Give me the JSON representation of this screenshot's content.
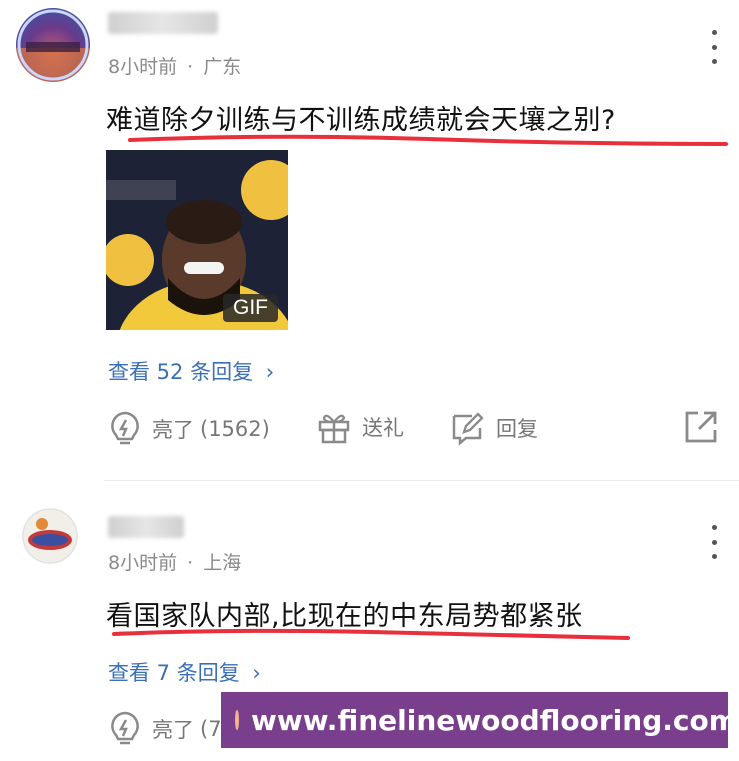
{
  "comments": [
    {
      "time": "8小时前",
      "separator": "·",
      "location": "广东",
      "text": "难道除夕训练与不训练成绩就会天壤之别?",
      "image_badge": "GIF",
      "replies_link": "查看 52 条回复",
      "actions": {
        "like_label": "亮了",
        "like_count": "(1562)",
        "gift_label": "送礼",
        "reply_label": "回复"
      }
    },
    {
      "time": "8小时前",
      "separator": "·",
      "location": "上海",
      "text": "看国家队内部,比现在的中东局势都紧张",
      "replies_link": "查看 7 条回复",
      "actions": {
        "like_label": "亮了",
        "like_count": "(78"
      }
    }
  ],
  "watermark": {
    "text": "www.finelinewoodflooring.com"
  },
  "colors": {
    "link": "#3b6fb6",
    "underline": "#e8303c",
    "watermark_bg": "#7a3f8c"
  }
}
